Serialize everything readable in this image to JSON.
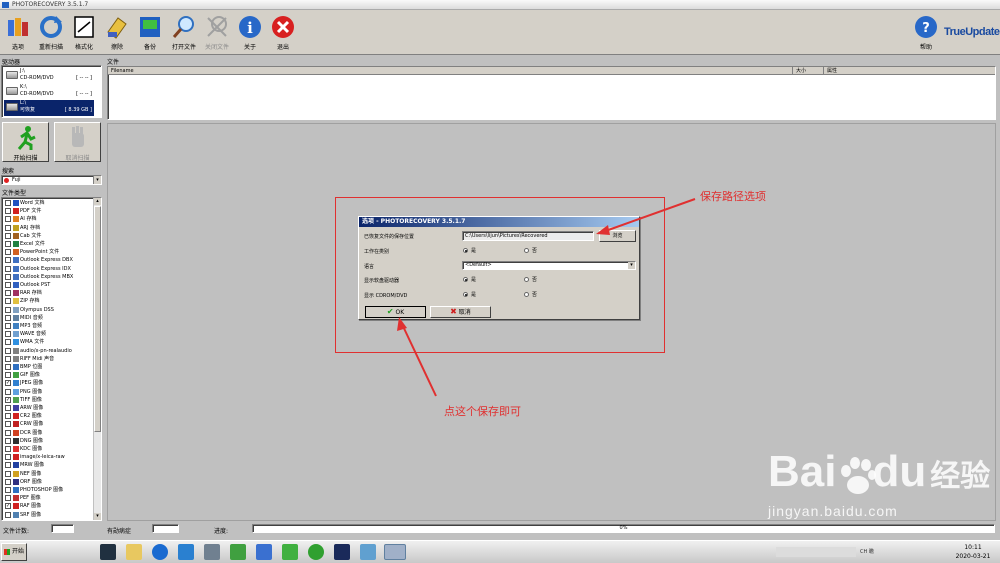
{
  "window": {
    "title": "PHOTORECOVERY 3.5.1.7"
  },
  "toolbar": {
    "buttons": [
      {
        "label": "选项",
        "icon": "options-icon"
      },
      {
        "label": "重新扫描",
        "icon": "rescan-icon"
      },
      {
        "label": "格式化",
        "icon": "format-icon"
      },
      {
        "label": "擦除",
        "icon": "erase-icon"
      },
      {
        "label": "备份",
        "icon": "backup-icon"
      },
      {
        "label": "打开文件",
        "icon": "open-file-icon"
      },
      {
        "label": "关闭文件",
        "icon": "close-file-icon"
      },
      {
        "label": "关于",
        "icon": "about-icon"
      },
      {
        "label": "退出",
        "icon": "exit-icon"
      }
    ],
    "help_label": "帮助",
    "trueupdate_label": "TrueUpdate"
  },
  "drives": {
    "label": "驱动器",
    "items": [
      {
        "name": "J:\\",
        "type": "CD-ROM/DVD",
        "size": "[ -- -- ]"
      },
      {
        "name": "K:\\",
        "type": "CD-ROM/DVD",
        "size": "[ -- -- ]"
      },
      {
        "name": "L:\\",
        "type": "可恢复",
        "size": "[ 8.39 GB ]"
      }
    ]
  },
  "scan": {
    "start_label": "开始扫描",
    "cancel_label": "取消扫描"
  },
  "search": {
    "label": "搜索",
    "value": "Fuji"
  },
  "filetypes": {
    "label": "文件类型",
    "items": [
      {
        "name": "Word 文档",
        "checked": false
      },
      {
        "name": "PDF 文件",
        "checked": false
      },
      {
        "name": "AI 存档",
        "checked": false
      },
      {
        "name": "ARJ 存档",
        "checked": false
      },
      {
        "name": "Cab 文件",
        "checked": false
      },
      {
        "name": "Excel 文件",
        "checked": false
      },
      {
        "name": "PowerPoint 文件",
        "checked": false
      },
      {
        "name": "Outlook Express DBX",
        "checked": false
      },
      {
        "name": "Outlook Express IDX",
        "checked": false
      },
      {
        "name": "Outlook Express MBX",
        "checked": false
      },
      {
        "name": "Outlook PST",
        "checked": false
      },
      {
        "name": "RAR 存档",
        "checked": false
      },
      {
        "name": "ZIP 存档",
        "checked": false
      },
      {
        "name": "Olympus DSS",
        "checked": false
      },
      {
        "name": "MIDI 音频",
        "checked": false
      },
      {
        "name": "MP3 音频",
        "checked": false
      },
      {
        "name": "WAVE 音频",
        "checked": false
      },
      {
        "name": "WMA 文件",
        "checked": false
      },
      {
        "name": "audio/x-pn-realaudio",
        "checked": false
      },
      {
        "name": "RIFF Midi 声音",
        "checked": false
      },
      {
        "name": "BMP 位图",
        "checked": false
      },
      {
        "name": "GIF 图像",
        "checked": false
      },
      {
        "name": "JPEG 图像",
        "checked": true
      },
      {
        "name": "PNG 图像",
        "checked": false
      },
      {
        "name": "TIFF 图像",
        "checked": true
      },
      {
        "name": "ARW 图像",
        "checked": false
      },
      {
        "name": "CR2 图像",
        "checked": false
      },
      {
        "name": "CRW 图像",
        "checked": false
      },
      {
        "name": "DCR 图像",
        "checked": false
      },
      {
        "name": "DNG 图像",
        "checked": false
      },
      {
        "name": "KDC 图像",
        "checked": false
      },
      {
        "name": "image/x-leica-raw",
        "checked": false
      },
      {
        "name": "MRW 图像",
        "checked": false
      },
      {
        "name": "NEF 图像",
        "checked": false
      },
      {
        "name": "ORF 图像",
        "checked": false
      },
      {
        "name": "PHOTOSHOP 图像",
        "checked": false
      },
      {
        "name": "PEF 图像",
        "checked": false
      },
      {
        "name": "RAF 图像",
        "checked": true
      },
      {
        "name": "SRF 图像",
        "checked": false
      }
    ]
  },
  "files": {
    "label": "文件",
    "columns": [
      "Filename",
      "大小",
      "属性"
    ]
  },
  "dialog": {
    "title": "选项 - PHOTORECOVERY 3.5.1.7",
    "save_path_label": "已恢复文件的保存位置",
    "save_path_value": "C:\\Users\\lijun\\Pictures\\Recovered",
    "browse_label": "浏览",
    "work_category_label": "工作在类别",
    "language_label": "语言",
    "language_value": "<Default>",
    "show_floppy_label": "显示软盘驱动器",
    "show_cdrom_label": "显示 CDROM/DVD",
    "yes_label": "是",
    "no_label": "否",
    "ok_label": "OK",
    "cancel_label": "取消"
  },
  "annotations": {
    "save_path_note": "保存路径选项",
    "save_note": "点这个保存即可"
  },
  "status": {
    "file_count_label": "文件计数:",
    "recovered_label": "有勋病症",
    "progress_label": "进度:",
    "progress_text": "0%",
    "progress_value": 0
  },
  "taskbar": {
    "start_label": "开始",
    "time": "10:11",
    "date": "2020-03-21",
    "ime_label": "CH 瞻"
  },
  "watermark": {
    "brand": "Bai",
    "brand2": "du",
    "cn": "经验",
    "url": "jingyan.baidu.com"
  },
  "colors": {
    "accent": "#0a246a",
    "annotation": "#e03030"
  }
}
